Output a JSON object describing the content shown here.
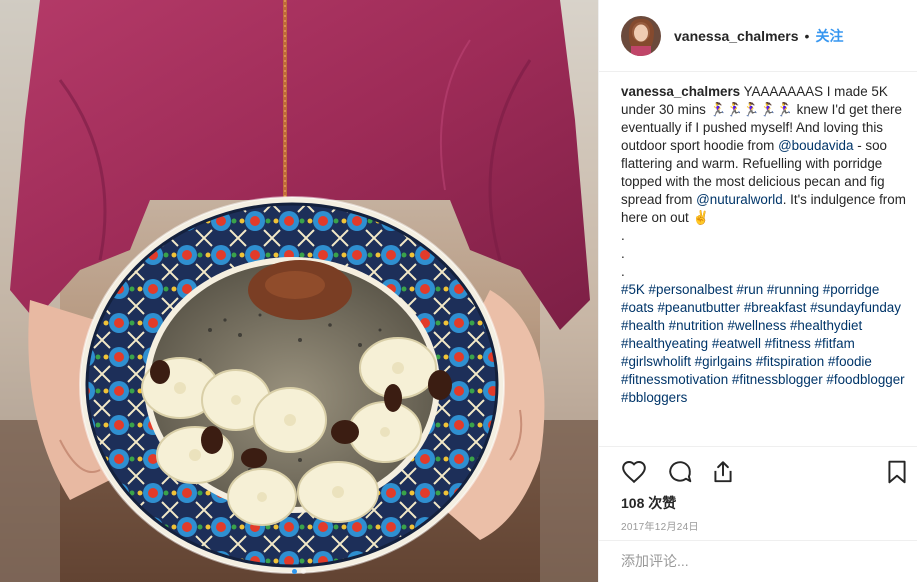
{
  "post": {
    "username": "vanessa_chalmers",
    "dot": "•",
    "follow_label": "关注",
    "caption_text": "YAAAAAAAS I made 5K under 30 mins 🏃‍♀️🏃‍♀️🏃‍♀️🏃‍♀️🏃‍♀️ knew I'd get there eventually if I pushed myself! And loving this outdoor sport hoodie from ",
    "mention_1": "@boudavida",
    "caption_mid": " - soo flattering and warm. Refuelling with porridge topped with the most delicious pecan and fig spread from ",
    "mention_2": "@nuturalworld",
    "caption_end": ". It's indulgence from here on out ✌️",
    "dots": ".\n.\n.",
    "hashtags": "#5K #personalbest #run #running #porridge #oats #peanutbutter #breakfast #sundayfunday #health #nutrition #wellness #healthydiet #healthyeating #eatwell #fitness #fitfam #girlswholift #girlgains #fitspiration #foodie #fitnessmotivation #fitnessblogger #foodblogger #bbloggers",
    "likes": "108 次赞",
    "date": "2017年12月24日",
    "comment_placeholder": "添加评论..."
  },
  "icons": {
    "like": "heart-icon",
    "comment": "comment-bubble-icon",
    "share": "share-upload-icon",
    "save": "bookmark-icon"
  },
  "colors": {
    "link": "#003569",
    "follow": "#3897f0",
    "muted": "#999999",
    "hoodie": "#a8325f"
  }
}
